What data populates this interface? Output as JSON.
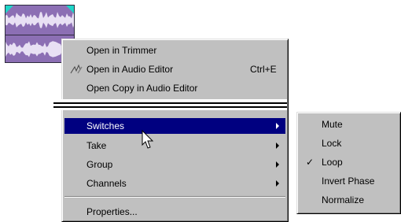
{
  "clip": {
    "name": "audio clip",
    "color": "#8c6fb4",
    "handle_color": "#1ed6c8"
  },
  "context_menu": {
    "items_top": [
      {
        "label": "Open in Trimmer",
        "accel": ""
      },
      {
        "label": "Open in Audio Editor",
        "accel": "Ctrl+E",
        "icon": "audio-editor-icon"
      },
      {
        "label": "Open Copy in Audio Editor",
        "accel": ""
      }
    ],
    "items_bottom": [
      {
        "label": "Switches",
        "submenu": true,
        "highlighted": true
      },
      {
        "label": "Take",
        "submenu": true
      },
      {
        "label": "Group",
        "submenu": true
      },
      {
        "label": "Channels",
        "submenu": true
      },
      {
        "label": "Properties...",
        "submenu": false
      }
    ],
    "highlight_color": "#000080"
  },
  "switches_submenu": {
    "items": [
      {
        "label": "Mute",
        "checked": false
      },
      {
        "label": "Lock",
        "checked": false
      },
      {
        "label": "Loop",
        "checked": true
      },
      {
        "label": "Invert Phase",
        "checked": false
      },
      {
        "label": "Normalize",
        "checked": false
      }
    ],
    "check_glyph": "✓"
  }
}
